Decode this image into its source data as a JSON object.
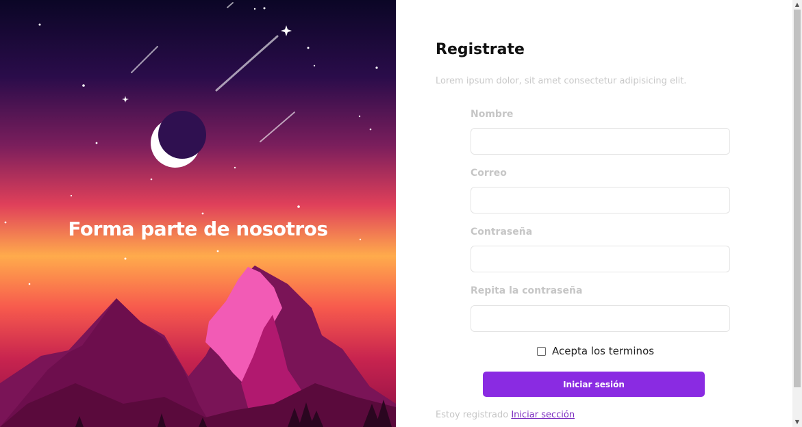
{
  "hero": {
    "title": "Forma parte de nosotros"
  },
  "form": {
    "title": "Registrate",
    "subtitle": "Lorem ipsum dolor, sit amet consectetur adipisicing elit.",
    "fields": [
      {
        "label": "Nombre",
        "value": "",
        "placeholder": ""
      },
      {
        "label": "Correo",
        "value": "",
        "placeholder": ""
      },
      {
        "label": "Contraseña",
        "value": "",
        "placeholder": ""
      },
      {
        "label": "Repita la contraseña",
        "value": "",
        "placeholder": ""
      }
    ],
    "terms_label": "Acepta los terminos",
    "terms_checked": false,
    "submit_label": "Iniciar sesión",
    "footer_text": "Estoy registrado",
    "footer_link": "Iniciar sección"
  },
  "colors": {
    "accent": "#8a2be2",
    "link": "#7b2cbf",
    "label": "#c6c6c6"
  },
  "icons": {
    "scroll_up": "chevron-up-icon",
    "scroll_down": "chevron-down-icon"
  }
}
